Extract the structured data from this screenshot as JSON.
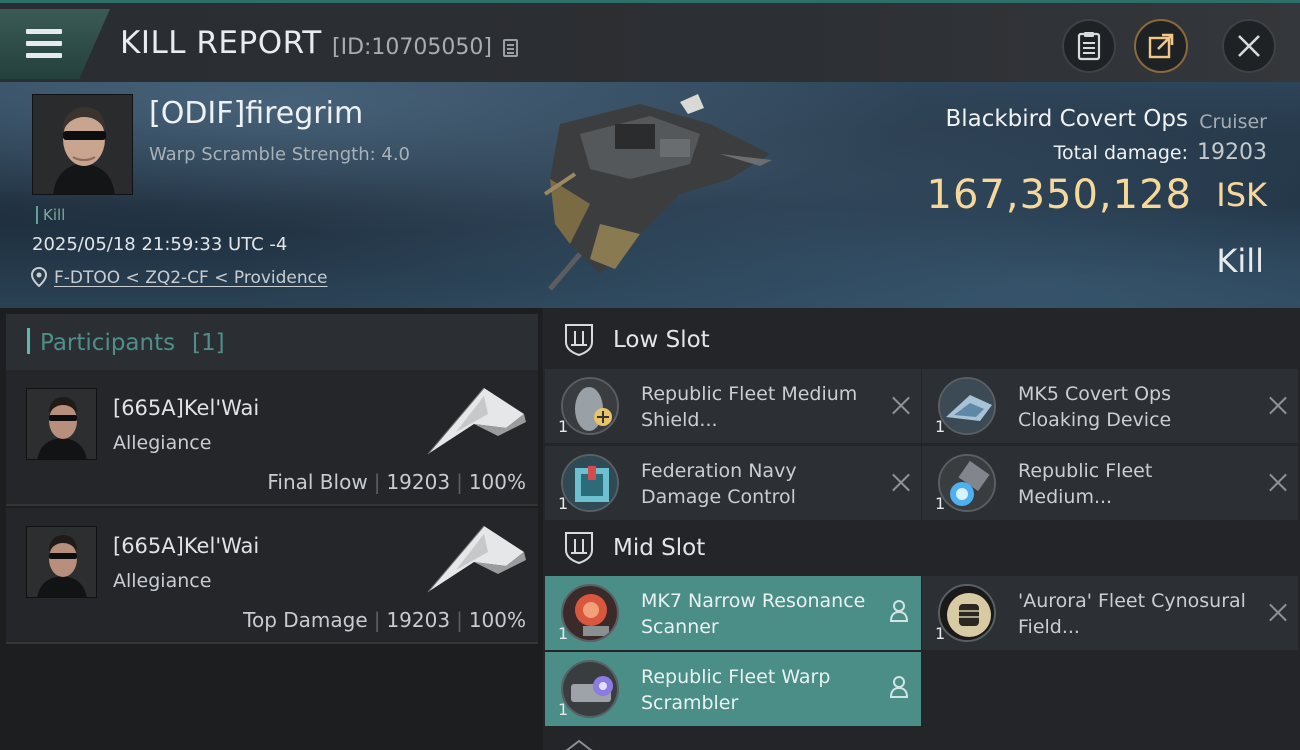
{
  "header": {
    "title": "KILL REPORT",
    "report_id": "[ID:10705050]"
  },
  "victim": {
    "pilot_name": "[ODIF]firegrim",
    "scramble": "Warp Scramble Strength: 4.0",
    "tag": "Kill",
    "time": "2025/05/18 21:59:33 UTC -4",
    "location": "F-DTOO < ZQ2-CF < Providence",
    "ship_name": "Blackbird Covert Ops",
    "ship_class": "Cruiser",
    "damage_label": "Total damage:",
    "damage_value": "19203",
    "isk_value": "167,350,128",
    "isk_unit": "ISK",
    "result": "Kill"
  },
  "participants": {
    "title": "Participants",
    "count": "[1]",
    "items": [
      {
        "name": "[665A]Kel'Wai",
        "ship": "Allegiance",
        "role": "Final Blow",
        "damage": "19203",
        "percent": "100%"
      },
      {
        "name": "[665A]Kel'Wai",
        "ship": "Allegiance",
        "role": "Top Damage",
        "damage": "19203",
        "percent": "100%"
      }
    ]
  },
  "slots": {
    "low": {
      "title": "Low Slot",
      "items": [
        {
          "qty": "1",
          "name": "Republic Fleet Medium Shield...",
          "icon": "shield-extender-icon"
        },
        {
          "qty": "1",
          "name": "MK5 Covert Ops Cloaking Device",
          "icon": "cloak-icon"
        },
        {
          "qty": "1",
          "name": "Federation Navy Damage Control",
          "icon": "damage-control-icon"
        },
        {
          "qty": "1",
          "name": "Republic Fleet Medium...",
          "icon": "propulsion-icon"
        }
      ]
    },
    "mid": {
      "title": "Mid Slot",
      "items": [
        {
          "qty": "1",
          "name": "MK7 Narrow Resonance Scanner",
          "icon": "scanner-icon"
        },
        {
          "qty": "1",
          "name": "'Aurora' Fleet Cynosural Field...",
          "icon": "fist-icon"
        },
        {
          "qty": "1",
          "name": "Republic Fleet Warp Scrambler",
          "icon": "warp-scrambler-icon"
        }
      ]
    }
  },
  "colors": {
    "accent": "#4b8d87",
    "isk": "#f5d89a"
  }
}
